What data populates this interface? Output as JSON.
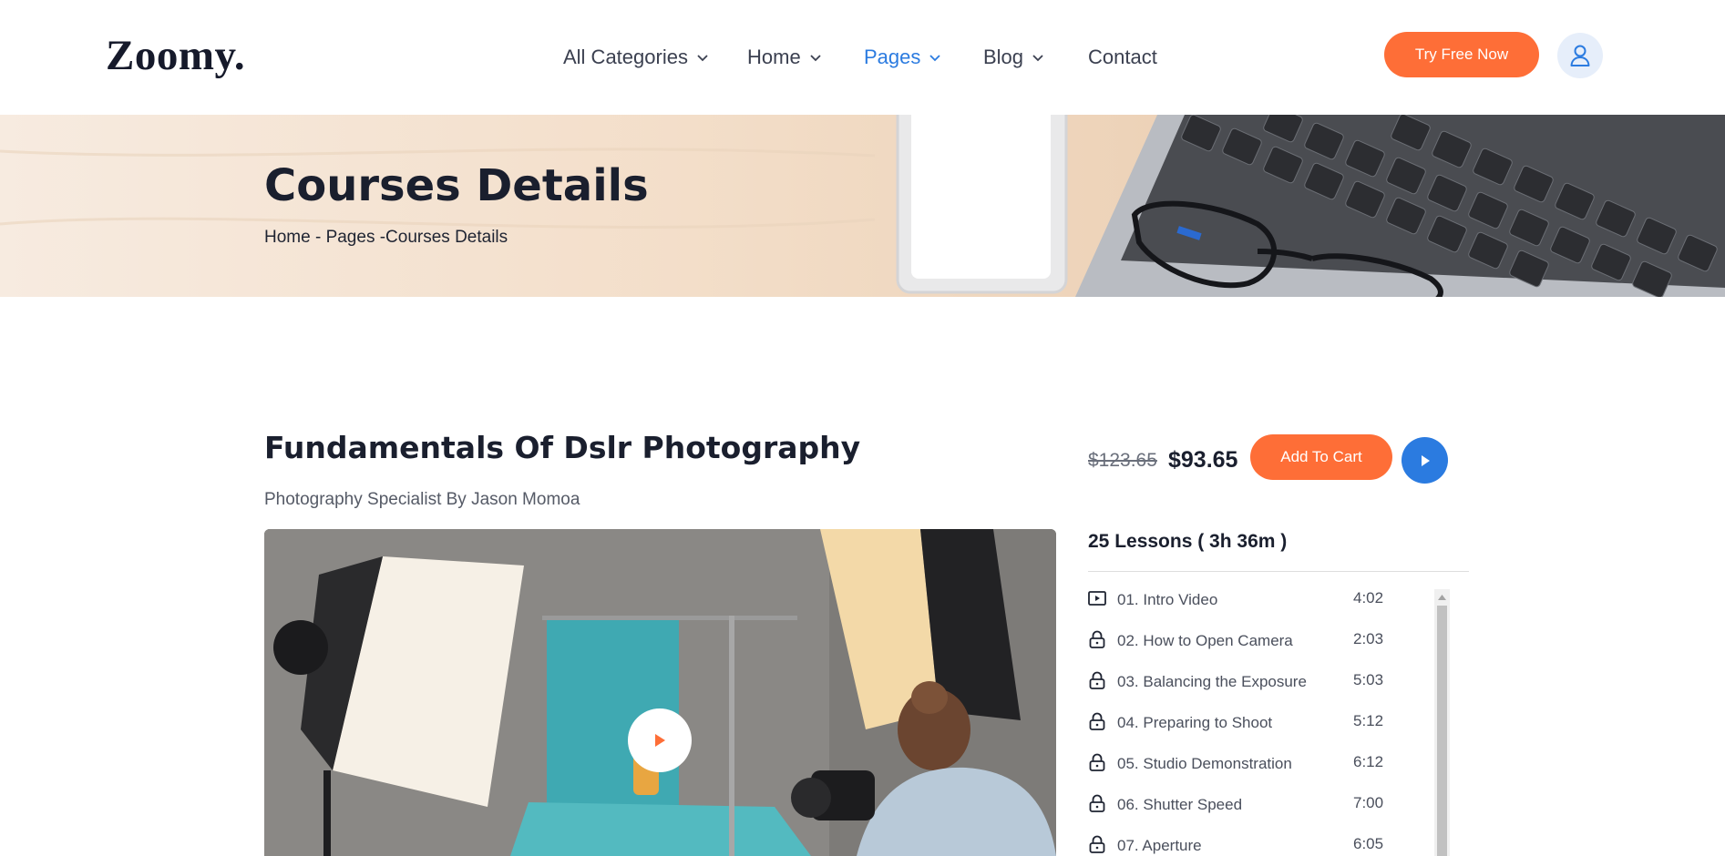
{
  "header": {
    "logo": "Zoomy.",
    "nav": [
      {
        "label": "All Categories",
        "dropdown": true,
        "active": false
      },
      {
        "label": "Home",
        "dropdown": true,
        "active": false
      },
      {
        "label": "Pages",
        "dropdown": true,
        "active": true
      },
      {
        "label": "Blog",
        "dropdown": true,
        "active": false
      },
      {
        "label": "Contact",
        "dropdown": false,
        "active": false
      }
    ],
    "cta_label": "Try Free Now",
    "user_icon": "user-icon"
  },
  "banner": {
    "title": "Courses Details",
    "breadcrumb": "Home - Pages -Courses Details"
  },
  "course": {
    "title": "Fundamentals Of Dslr Photography",
    "subtitle": "Photography Specialist By Jason Momoa",
    "old_price": "$123.65",
    "price": "$93.65",
    "add_to_cart": "Add To Cart",
    "lessons_heading": "25 Lessons ( 3h 36m )",
    "lessons": [
      {
        "title": "01. Intro Video",
        "duration": "4:02",
        "icon": "play-video-icon"
      },
      {
        "title": "02. How to Open Camera",
        "duration": "2:03",
        "icon": "lock-icon"
      },
      {
        "title": "03. Balancing the Exposure",
        "duration": "5:03",
        "icon": "lock-icon"
      },
      {
        "title": "04. Preparing to Shoot",
        "duration": "5:12",
        "icon": "lock-icon"
      },
      {
        "title": "05. Studio Demonstration",
        "duration": "6:12",
        "icon": "lock-icon"
      },
      {
        "title": "06. Shutter Speed",
        "duration": "7:00",
        "icon": "lock-icon"
      },
      {
        "title": "07. Aperture",
        "duration": "6:05",
        "icon": "lock-icon"
      }
    ]
  },
  "colors": {
    "accent_orange": "#fe6e37",
    "accent_blue": "#2b7be0",
    "dark_text": "#1a1f2e"
  }
}
